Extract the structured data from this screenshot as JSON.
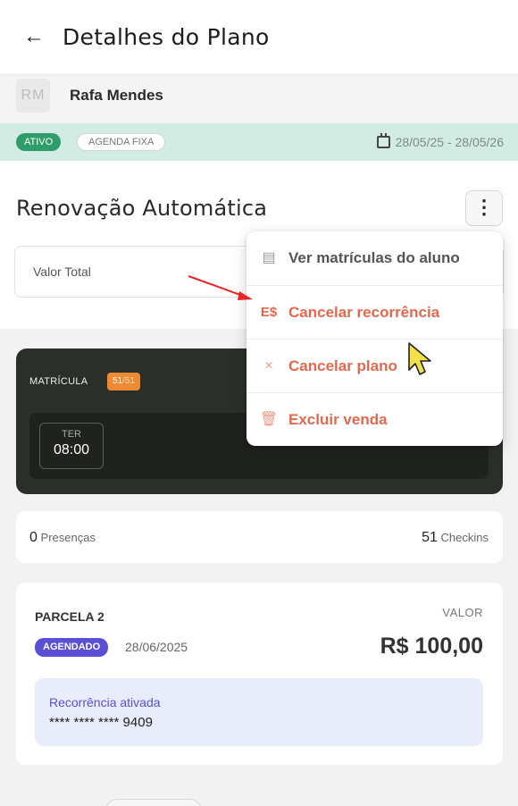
{
  "header": {
    "back_icon": "arrow-left-icon",
    "title": "Detalhes do Plano"
  },
  "student": {
    "initials": "RM",
    "name": "Rafa Mendes"
  },
  "status_bar": {
    "status": "ATIVO",
    "schedule_type": "AGENDA FIXA",
    "period_icon": "calendar-icon",
    "period": "28/05/25 - 28/05/26"
  },
  "plan": {
    "title": "Renovação Automática",
    "menu_icon": "kebab-menu-icon",
    "total_label": "Valor Total"
  },
  "enrollment": {
    "label": "MATRÍCULA",
    "count": "51",
    "count_total": "/51",
    "day": "TER",
    "time": "08:00"
  },
  "stats": {
    "presencas_value": "0",
    "presencas_label": " Presenças",
    "checkins_value": "51",
    "checkins_label": " Checkins"
  },
  "parcel": {
    "label": "PARCELA 2",
    "value_label": "VALOR",
    "status": "AGENDADO",
    "date": "28/06/2025",
    "value": "R$ 100,00",
    "recurrence_title": "Recorrência ativada",
    "card_number": "**** **** **** 9409"
  },
  "menu": {
    "items": [
      {
        "label": "Ver matrículas do aluno",
        "icon": "calendar-icon",
        "glyph": "▤"
      },
      {
        "label": "Cancelar recorrência",
        "icon": "cancel-recurrence-icon",
        "glyph": "E$"
      },
      {
        "label": "Cancelar plano",
        "icon": "close-icon",
        "glyph": "×"
      },
      {
        "label": "Excluir venda",
        "icon": "trash-icon",
        "glyph": "🗑"
      }
    ]
  },
  "colors": {
    "accent_red": "#e2694f",
    "active_green": "#2e9d6a",
    "scheduled_purple": "#5b4fd6",
    "enroll_orange": "#ef8a34"
  }
}
